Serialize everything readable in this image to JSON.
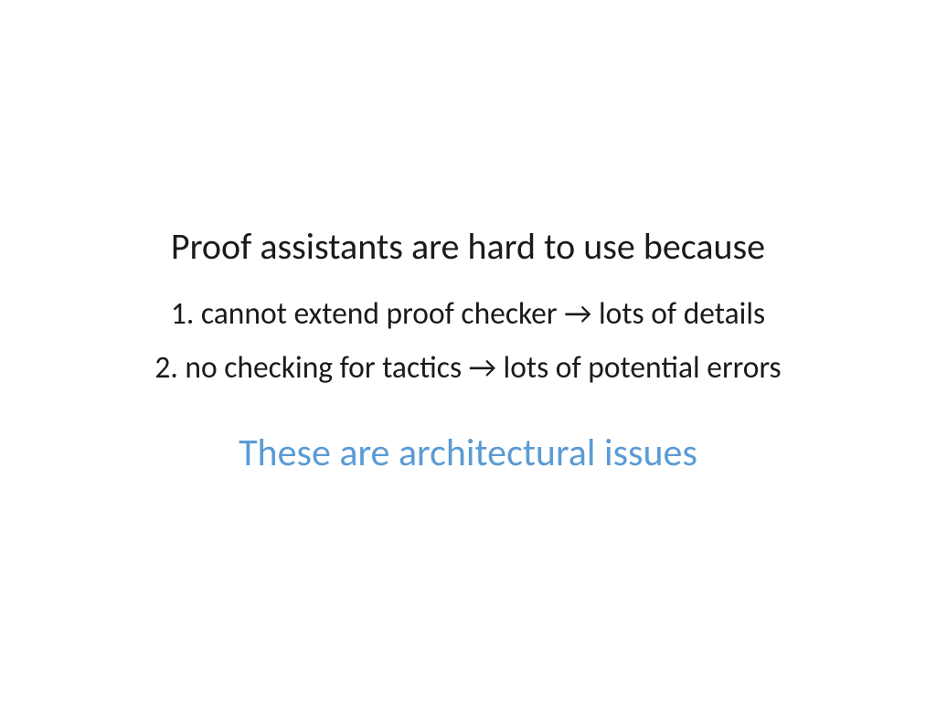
{
  "slide": {
    "heading": "Proof assistants are hard to use because",
    "point1": "1. cannot extend proof checker → lots of details",
    "point2": "2. no checking for tactics → lots of potential errors",
    "conclusion": "These are architectural issues"
  }
}
